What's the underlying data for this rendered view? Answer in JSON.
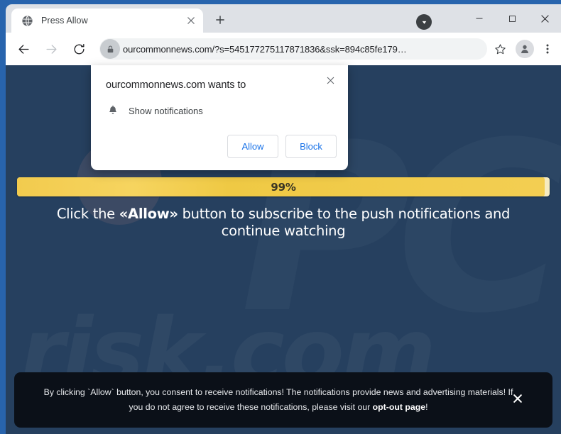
{
  "browser": {
    "tab": {
      "title": "Press Allow",
      "favicon": "globe-icon",
      "close_label": "×"
    },
    "new_tab_label": "+",
    "window_controls": {
      "minimize": "—",
      "maximize": "□",
      "close": "✕"
    },
    "tab_search_icon": "chevron-down-circle-icon",
    "nav": {
      "back": "←",
      "forward": "→",
      "reload": "⟳"
    },
    "omnibox": {
      "url": "ourcommonnews.com/?s=545177275117871836&ssk=894c85fe179…",
      "lock_icon": "lock-icon",
      "star_icon": "star-outline-icon"
    },
    "profile_icon": "person-icon",
    "menu_icon": "three-dot-menu-icon"
  },
  "permission_dialog": {
    "title": "ourcommonnews.com wants to",
    "permission_icon": "bell-icon",
    "permission_label": "Show notifications",
    "allow_label": "Allow",
    "block_label": "Block",
    "close_label": "✕"
  },
  "page": {
    "progress": {
      "value": 99,
      "label": "99%",
      "fill_color": "#F2CB4E",
      "track_color": "#F6EBC0"
    },
    "headline": {
      "before": "Click the ",
      "emphasis": "«Allow»",
      "after": " button to subscribe to the push notifications and continue watching"
    },
    "background_color": "#26405F",
    "watermark": {
      "logo": "PC",
      "text": "risk.com"
    }
  },
  "consent_banner": {
    "text_before_link": "By clicking `Allow` button, you consent to receive notifications! The notifications provide news and advertising materials! If you do not agree to receive these notifications, please visit our ",
    "link_label": "opt-out page",
    "text_after_link": "!",
    "close_label": "✕",
    "background_color": "#0B1018"
  }
}
